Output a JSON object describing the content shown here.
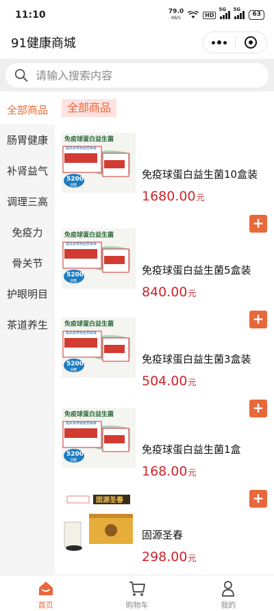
{
  "status_bar": {
    "time": "11:10",
    "speed_value": "79.0",
    "speed_unit": "KB/S",
    "hd": "HD",
    "signal1": "5G",
    "signal2": "5G",
    "battery": "63"
  },
  "header": {
    "title": "91健康商城"
  },
  "search": {
    "placeholder": "请输入搜索内容"
  },
  "sidebar": {
    "items": [
      {
        "label": "全部商品",
        "active": true
      },
      {
        "label": "肠胃健康"
      },
      {
        "label": "补肾益气"
      },
      {
        "label": "调理三高"
      },
      {
        "label": "免疫力"
      },
      {
        "label": "骨关节"
      },
      {
        "label": "护眼明目"
      },
      {
        "label": "茶道养生"
      }
    ]
  },
  "main": {
    "category_title": "全部商品",
    "products": [
      {
        "name": "免疫球蛋白益生菌10盒装",
        "price": "1680.00",
        "unit": "元",
        "image": "immune-probiotic-box",
        "image_text": {
          "title": "免疫球蛋白益生菌",
          "subtitle": "提高身体免疫抗病毒",
          "badge": "5200",
          "badge_sub": "活菌"
        }
      },
      {
        "name": "免疫球蛋白益生菌5盒装",
        "price": "840.00",
        "unit": "元",
        "image": "immune-probiotic-box",
        "image_text": {
          "title": "免疫球蛋白益生菌",
          "subtitle": "提高身体免疫抗病毒",
          "badge": "5200",
          "badge_sub": "活菌"
        }
      },
      {
        "name": "免疫球蛋白益生菌3盒装",
        "price": "504.00",
        "unit": "元",
        "image": "immune-probiotic-box",
        "image_text": {
          "title": "免疫球蛋白益生菌",
          "subtitle": "提高身体免疫抗病毒",
          "badge": "5200",
          "badge_sub": "活菌"
        }
      },
      {
        "name": "免疫球蛋白益生菌1盒",
        "price": "168.00",
        "unit": "元",
        "image": "immune-probiotic-box",
        "image_text": {
          "title": "免疫球蛋白益生菌",
          "subtitle": "提高身体免疫抗病毒",
          "badge": "5200",
          "badge_sub": "活菌"
        }
      },
      {
        "name": "固源圣春",
        "price": "298.00",
        "unit": "元",
        "image": "guyuan-shengchun-box",
        "image_text": {
          "title": "固源圣春"
        }
      }
    ],
    "add_symbol": "+"
  },
  "tabbar": {
    "items": [
      {
        "label": "首页",
        "icon": "home-icon",
        "active": true
      },
      {
        "label": "购物车",
        "icon": "cart-icon"
      },
      {
        "label": "我的",
        "icon": "profile-icon"
      }
    ]
  },
  "colors": {
    "accent": "#e8683a",
    "price": "#d1232a",
    "category_bg": "#fde2e0"
  }
}
